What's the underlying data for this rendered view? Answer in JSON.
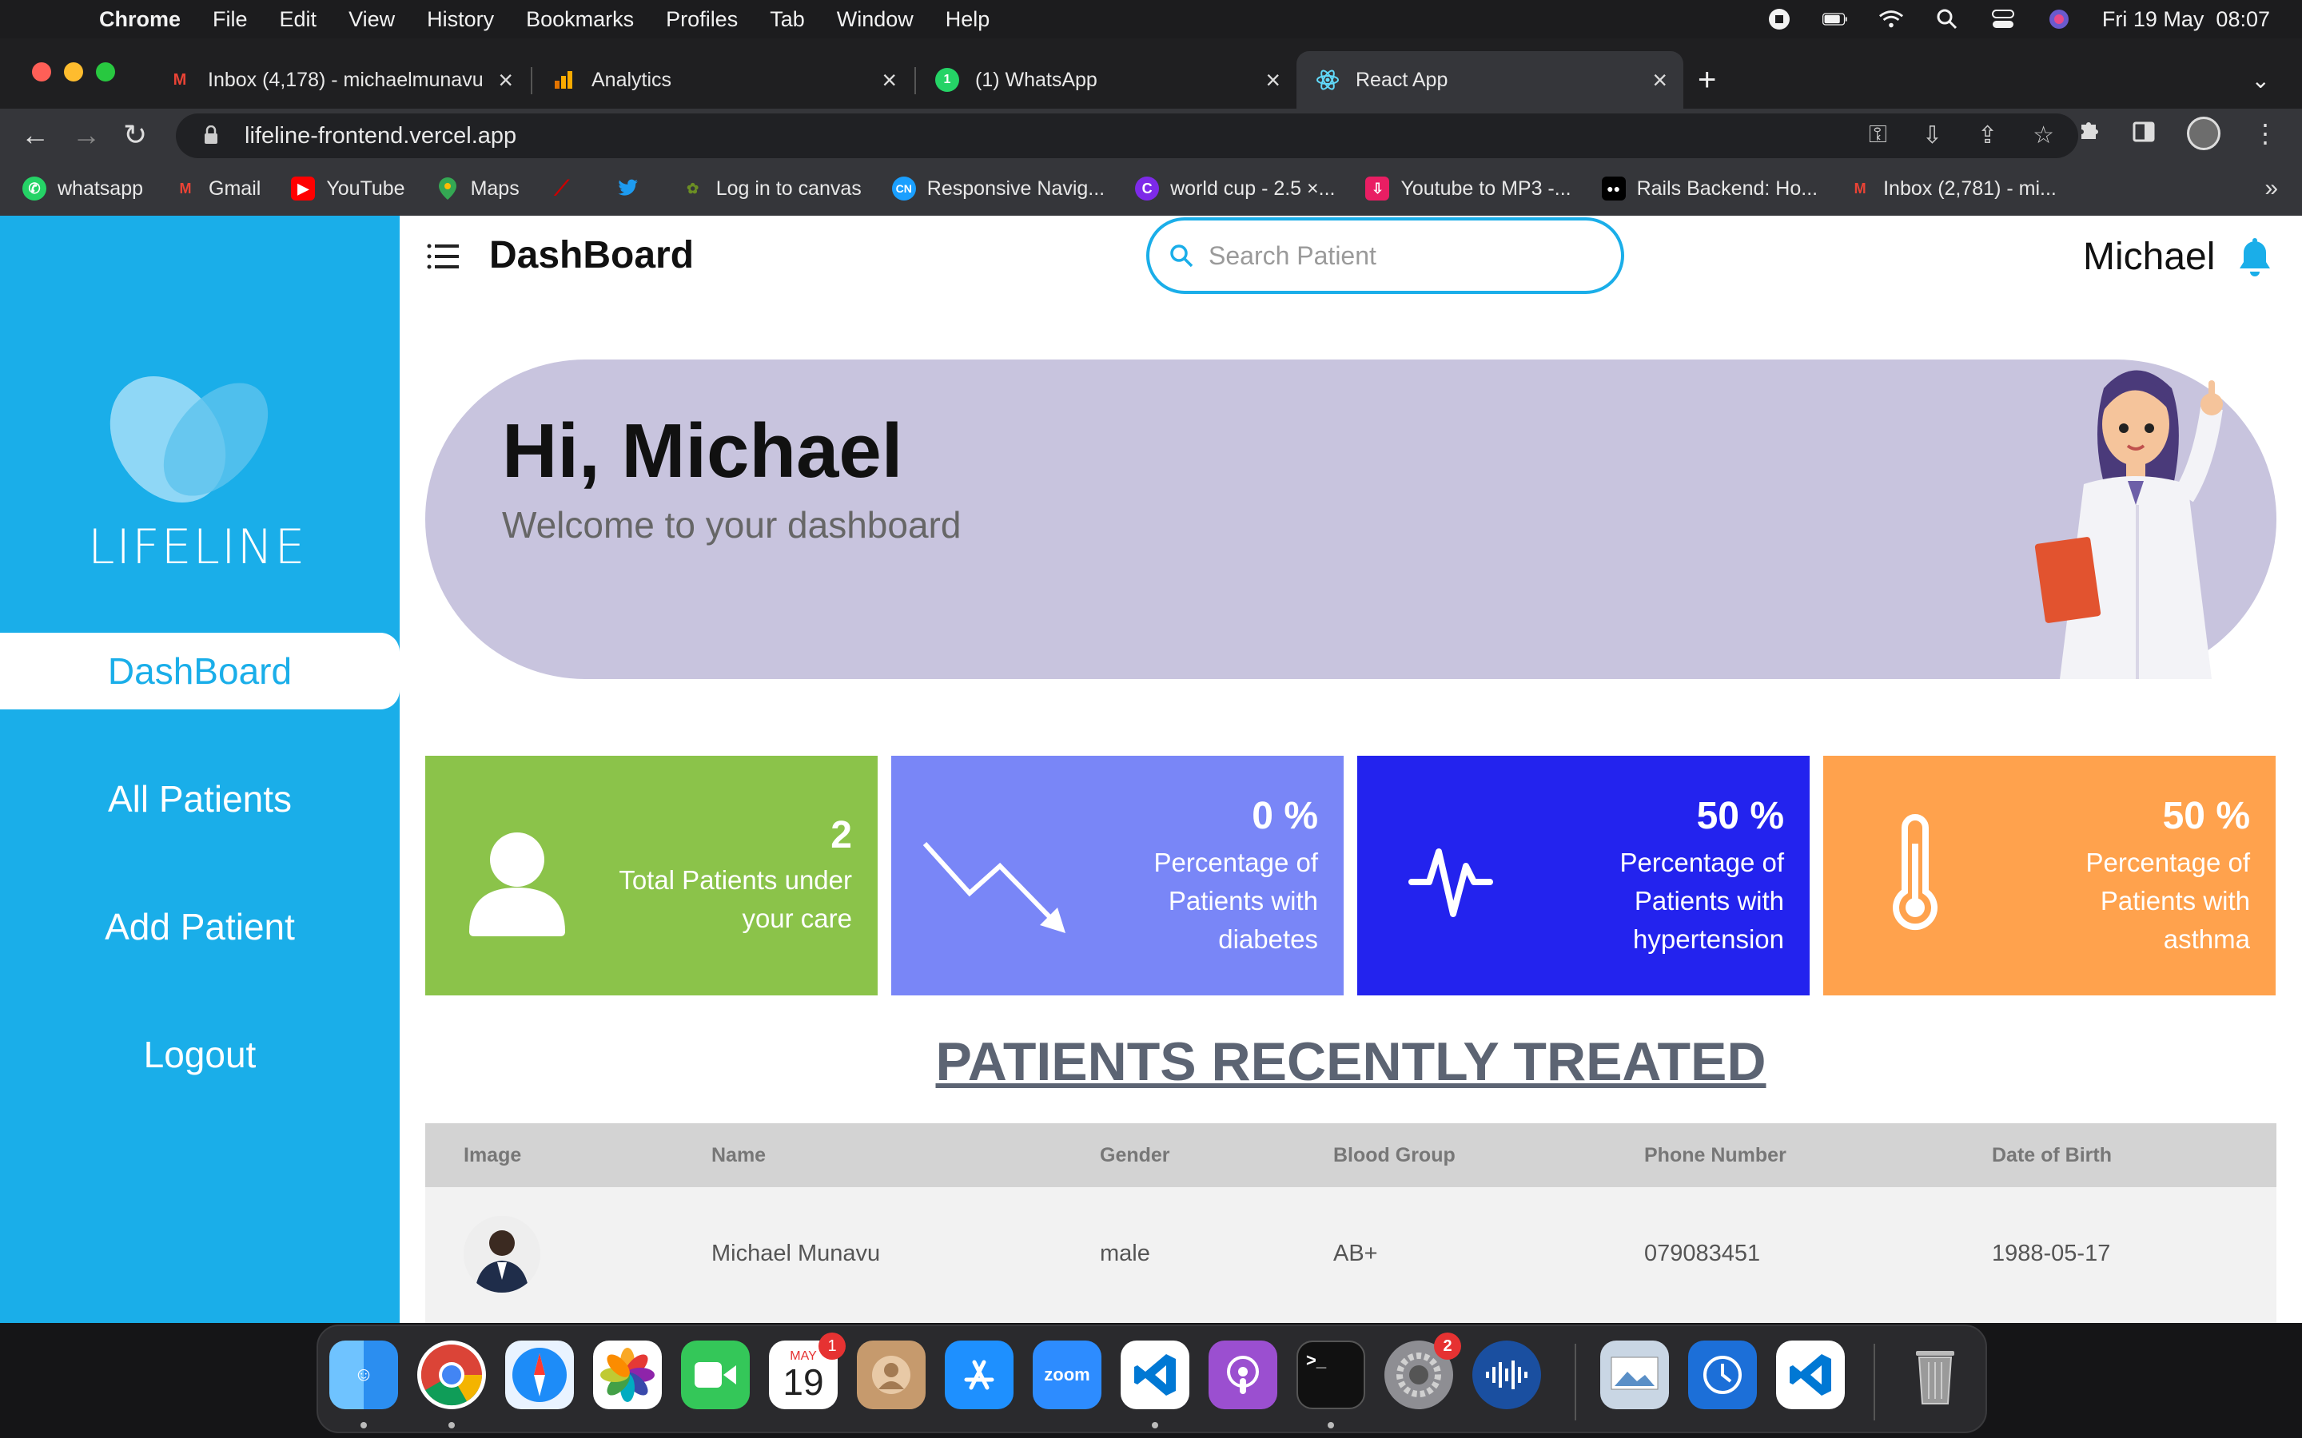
{
  "menubar": {
    "app": "Chrome",
    "items": [
      "File",
      "Edit",
      "View",
      "History",
      "Bookmarks",
      "Profiles",
      "Tab",
      "Window",
      "Help"
    ],
    "datetime": "Fri 19 May  08:07"
  },
  "tabs": [
    {
      "title": "Inbox (4,178) - michaelmunavu",
      "icon": "gmail-icon",
      "color": "#ea4335"
    },
    {
      "title": "Analytics",
      "icon": "analytics-icon",
      "color": "#f9ab00"
    },
    {
      "title": "(1) WhatsApp",
      "icon": "whatsapp-icon",
      "color": "#25d366"
    },
    {
      "title": "React App",
      "icon": "react-icon",
      "color": "#61dafb"
    }
  ],
  "address": {
    "url": "lifeline-frontend.vercel.app"
  },
  "bookmarks": [
    {
      "label": "whatsapp",
      "icon": "whatsapp-icon",
      "color": "#25d366"
    },
    {
      "label": "Gmail",
      "icon": "gmail-icon",
      "color": "#ea4335"
    },
    {
      "label": "YouTube",
      "icon": "youtube-icon",
      "color": "#ff0000"
    },
    {
      "label": "Maps",
      "icon": "maps-icon",
      "color": "#34a853"
    },
    {
      "label": "",
      "icon": "rails-icon",
      "color": "#cc0000"
    },
    {
      "label": "",
      "icon": "twitter-icon",
      "color": "#1d9bf0"
    },
    {
      "label": "Log in to canvas",
      "icon": "canvas-icon",
      "color": "#6b8e23"
    },
    {
      "label": "Responsive Navig...",
      "icon": "codepen-icon",
      "color": "#1a9fff"
    },
    {
      "label": "world cup - 2.5 ×...",
      "icon": "canva-icon",
      "color": "#7d2ae8"
    },
    {
      "label": "Youtube to MP3 -...",
      "icon": "download-icon",
      "color": "#e91e63"
    },
    {
      "label": "Rails Backend: Ho...",
      "icon": "medium-icon",
      "color": "#000000"
    },
    {
      "label": "Inbox (2,781) - mi...",
      "icon": "gmail-icon",
      "color": "#ea4335"
    }
  ],
  "sidebar": {
    "brand": "LIFELINE",
    "items": [
      {
        "label": "DashBoard",
        "active": true
      },
      {
        "label": "All Patients",
        "active": false
      },
      {
        "label": "Add Patient",
        "active": false
      },
      {
        "label": "Logout",
        "active": false
      }
    ]
  },
  "header": {
    "title": "DashBoard",
    "search_placeholder": "Search Patient",
    "user": "Michael"
  },
  "hero": {
    "greeting": "Hi, Michael",
    "subtitle": "Welcome to your dashboard"
  },
  "stats": [
    {
      "value": "2",
      "label": "Total Patients under your care",
      "color": "#8bc34a",
      "icon": "user-icon"
    },
    {
      "value": "0 %",
      "label": "Percentage of Patients with diabetes",
      "color": "#7986f7",
      "icon": "trend-down-icon"
    },
    {
      "value": "50 %",
      "label": "Percentage of Patients with hypertension",
      "color": "#2323ee",
      "icon": "heartbeat-icon"
    },
    {
      "value": "50 %",
      "label": "Percentage of Patients with asthma",
      "color": "#ffa24d",
      "icon": "thermometer-icon"
    }
  ],
  "recent": {
    "title": "PATIENTS RECENTLY TREATED",
    "columns": [
      "Image",
      "Name",
      "Gender",
      "Blood Group",
      "Phone Number",
      "Date of Birth"
    ],
    "rows": [
      {
        "name": "Michael Munavu",
        "gender": "male",
        "blood_group": "AB+",
        "phone": "079083451",
        "dob": "1988-05-17"
      }
    ]
  },
  "dock": {
    "calendar_month": "MAY",
    "calendar_day": "19",
    "calendar_badge": "1",
    "settings_badge": "2",
    "zoom_label": "zoom"
  },
  "colors": {
    "sidebar": "#1aaee9",
    "hero": "#c8c4de"
  }
}
